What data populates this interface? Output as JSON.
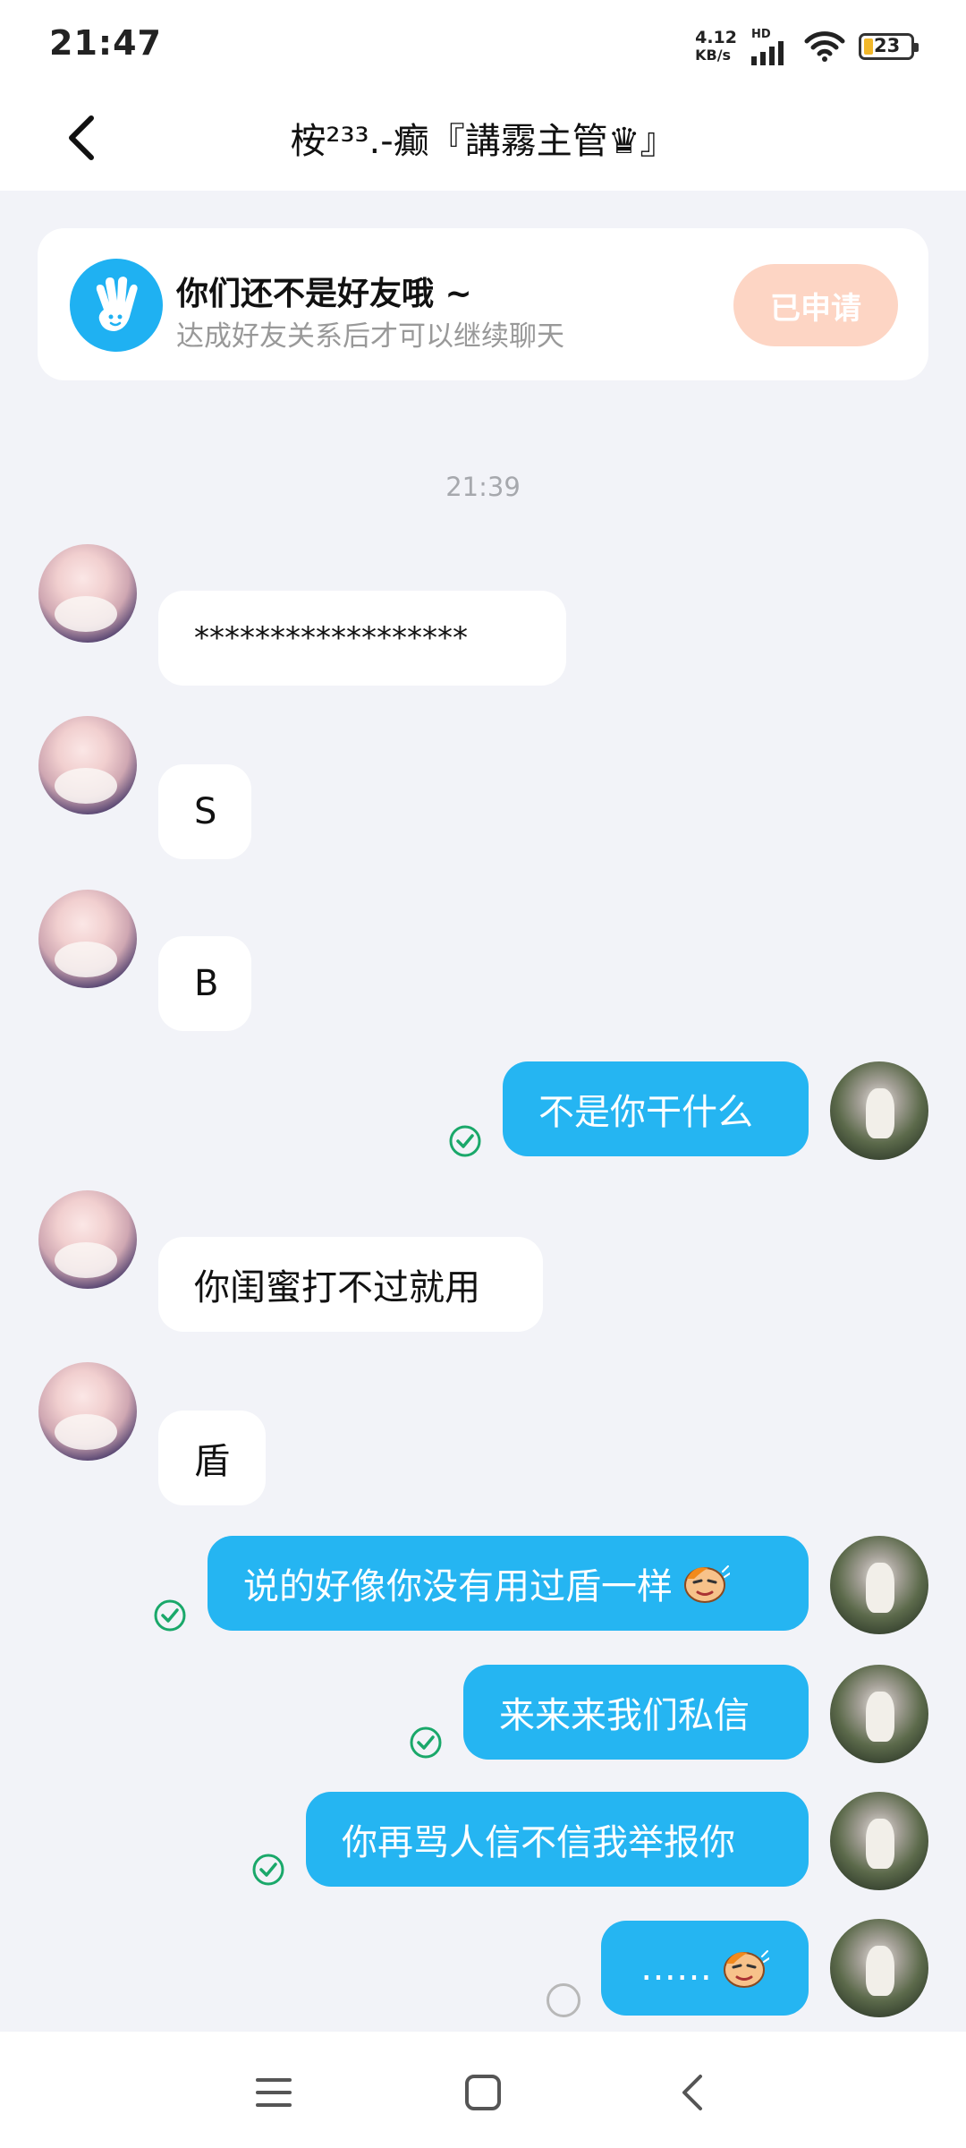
{
  "status_bar": {
    "time": "21:47",
    "net_speed_value": "4.12",
    "net_speed_unit": "KB/s",
    "hd_label": "HD",
    "battery_level": "23"
  },
  "header": {
    "title": "桉²³³.-癫『講霧主管♛』"
  },
  "friend_notice": {
    "title": "你们还不是好友哦 ~",
    "subtitle": "达成好友关系后才可以继续聊天",
    "button_label": "已申请"
  },
  "chat": {
    "time_divider": "21:39",
    "messages": [
      {
        "side": "them",
        "text": "******************"
      },
      {
        "side": "them",
        "text": "S"
      },
      {
        "side": "them",
        "text": "B"
      },
      {
        "side": "me",
        "text": "不是你干什么",
        "status": "read"
      },
      {
        "side": "them",
        "text": "你闺蜜打不过就用"
      },
      {
        "side": "them",
        "text": "盾"
      },
      {
        "side": "me",
        "text": "说的好像你没有用过盾一样",
        "emoji": "sly-face-emoji",
        "status": "read"
      },
      {
        "side": "me",
        "text": "来来来我们私信",
        "status": "read"
      },
      {
        "side": "me",
        "text": "你再骂人信不信我举报你",
        "status": "read"
      },
      {
        "side": "me",
        "text": "……",
        "emoji": "sly-face-emoji",
        "status": "sending"
      }
    ]
  },
  "colors": {
    "accent": "#25b5f2",
    "read_check": "#1aa86a",
    "applied_button": "#fdd5c4"
  }
}
